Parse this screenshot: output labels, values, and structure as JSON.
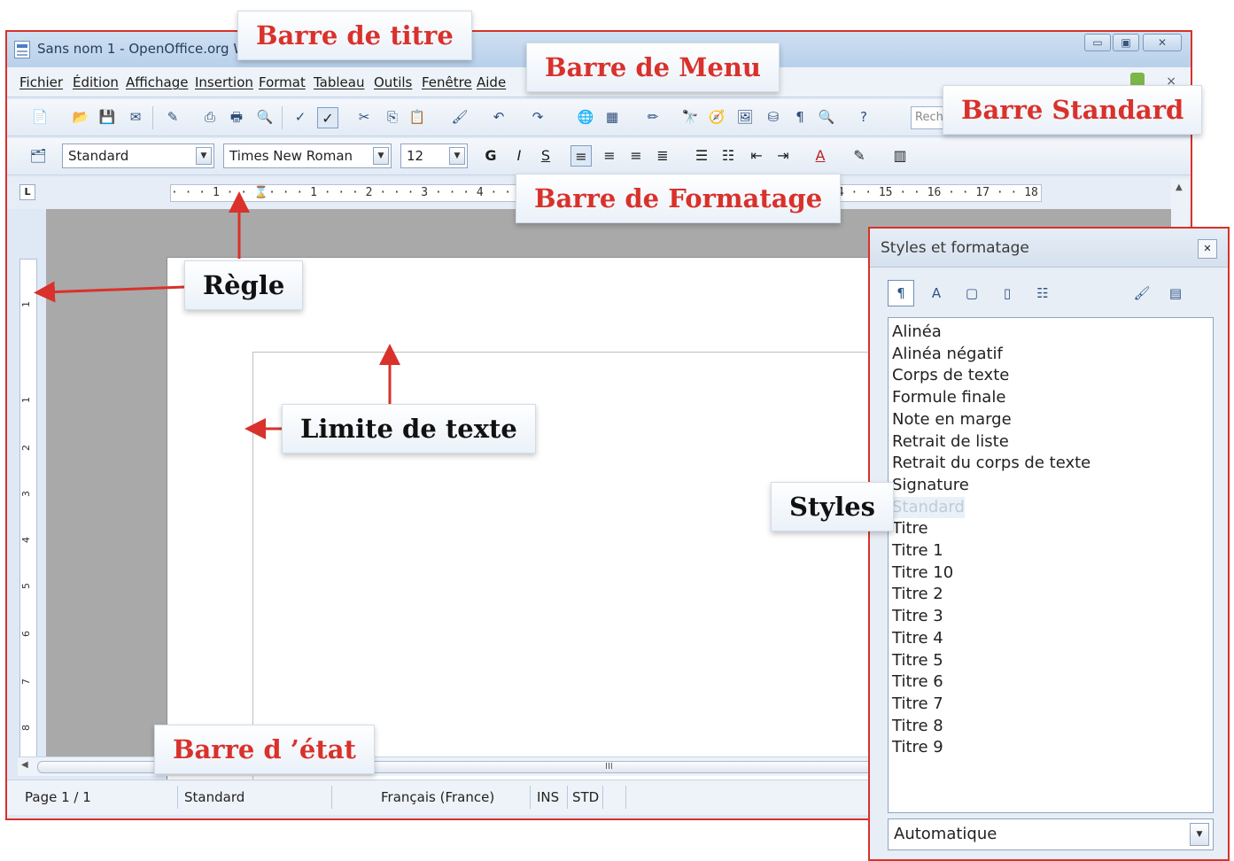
{
  "window": {
    "title": "Sans nom 1 - OpenOffice.org Writer",
    "minimize_glyph": "▭",
    "maximize_glyph": "▣",
    "close_glyph": "✕"
  },
  "menu": {
    "items": [
      "Fichier",
      "Édition",
      "Affichage",
      "Insertion",
      "Format",
      "Tableau",
      "Outils",
      "Fenêtre",
      "Aide"
    ],
    "doc_close": "×"
  },
  "standard_toolbar": {
    "find_placeholder": "Rech"
  },
  "format_toolbar": {
    "paragraph_style": "Standard",
    "font_name": "Times New Roman",
    "font_size": "12",
    "bold": "G",
    "italic": "I",
    "underline": "S",
    "dropdown_glyph": "▼"
  },
  "ruler": {
    "corner": "L",
    "horizontal_text": "· · · 1 · · ⌛· · · 1 · · · 2 · · · 3 · · · 4 · · · 5 · · · 6 ·                              · 14 · · 15 · · 16 · · 17 · · 18 · · ·",
    "vertical_ticks": [
      "1",
      "1",
      "2",
      "3",
      "4",
      "5",
      "6",
      "7",
      "8"
    ]
  },
  "scrollbar": {
    "grip": "III"
  },
  "status": {
    "page": "Page 1 / 1",
    "style": "Standard",
    "language": "Français (France)",
    "insert_mode": "INS",
    "selection_mode": "STD"
  },
  "styles_panel": {
    "title": "Styles et formatage",
    "close": "✕",
    "items": [
      "Alinéa",
      "Alinéa négatif",
      "Corps de texte",
      "Formule finale",
      "Note en marge",
      "Retrait de liste",
      "Retrait du corps de texte",
      "Signature",
      "Standard",
      "Titre",
      "Titre 1",
      "Titre 10",
      "Titre 2",
      "Titre 3",
      "Titre 4",
      "Titre 5",
      "Titre 6",
      "Titre 7",
      "Titre 8",
      "Titre 9"
    ],
    "selected_item": "Standard",
    "filter": "Automatique"
  },
  "callouts": {
    "title_bar": "Barre de titre",
    "menu_bar": "Barre de Menu",
    "standard_bar": "Barre  Standard",
    "format_bar": "Barre de Formatage",
    "ruler": "Règle",
    "text_limit": "Limite de texte",
    "styles": "Styles",
    "status_bar": "Barre d ’état"
  },
  "colors": {
    "accent_red": "#d9312b",
    "window_blue": "#dfe9f5"
  }
}
